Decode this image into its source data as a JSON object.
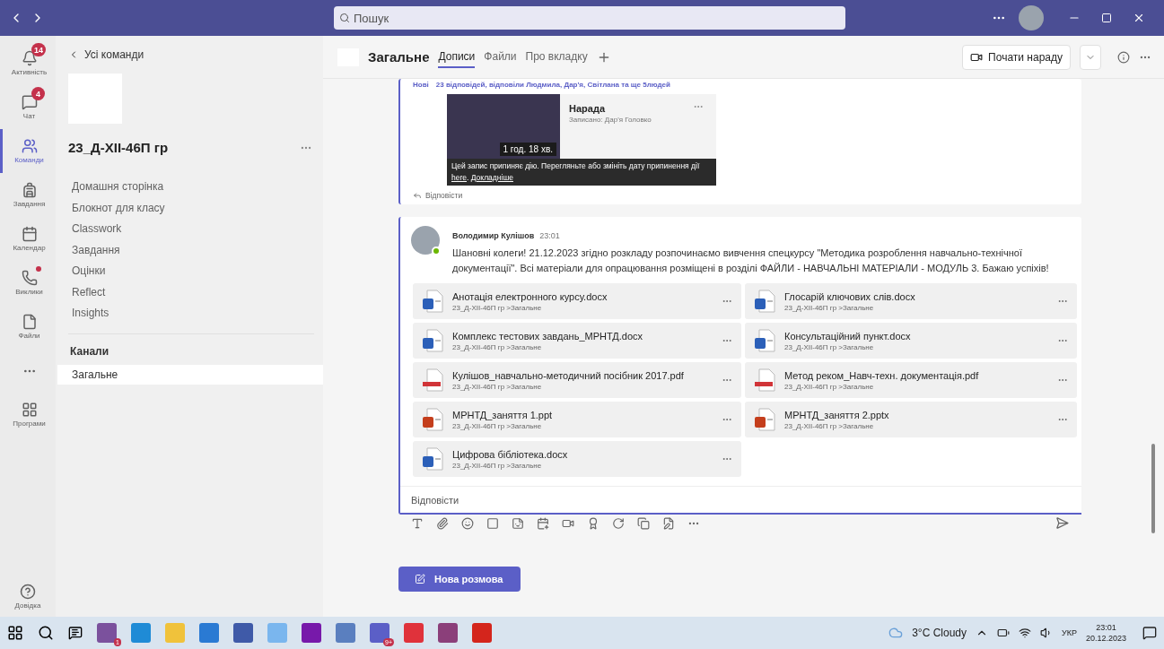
{
  "titlebar": {
    "search_placeholder": "Пошук"
  },
  "rail": [
    {
      "label": "Активність",
      "badge": "14",
      "alert": false,
      "selected": false
    },
    {
      "label": "Чат",
      "badge": "4",
      "alert": false,
      "selected": false
    },
    {
      "label": "Команди",
      "alert": false,
      "selected": true
    },
    {
      "label": "Завдання",
      "alert": false,
      "selected": false
    },
    {
      "label": "Календар",
      "alert": false,
      "selected": false
    },
    {
      "label": "Виклики",
      "alert": true,
      "selected": false
    },
    {
      "label": "Файли",
      "alert": false,
      "selected": false
    }
  ],
  "rail_apps": {
    "label": "Програми"
  },
  "rail_help": {
    "label": "Довідка"
  },
  "team_panel": {
    "back": "Усі команди",
    "team_name": "23_Д-XII-46П гр",
    "nav": [
      "Домашня сторінка",
      "Блокнот для класу",
      "Classwork",
      "Завдання",
      "Оцінки",
      "Reflect",
      "Insights"
    ],
    "section": "Канали",
    "channels": [
      {
        "label": "Загальне",
        "selected": true
      }
    ]
  },
  "header": {
    "channel": "Загальне",
    "tabs": [
      {
        "label": "Дописи",
        "selected": true
      },
      {
        "label": "Файли",
        "selected": false
      },
      {
        "label": "Про вкладку",
        "selected": false
      }
    ],
    "meet_button": "Почати нараду"
  },
  "thread": {
    "new_label": "Нові",
    "replies_summary": "23 відповідей, відповіли Людмила, Дар'я, Світлана та ще 5людей",
    "recording": {
      "title": "Нарада",
      "recorded_by": "Записано: Дар'я Головко",
      "duration": "1 год. 18 хв.",
      "notice": "Цей запис припиняє дію. Перегляньте або змініть дату припинення дії",
      "link": "here",
      "notice_end": ".",
      "link2": "Докладніше"
    },
    "reply": "Відповісти"
  },
  "message": {
    "author": "Володимир Кулішов",
    "time": "23:01",
    "body": "Шановні колеги! 21.12.2023 згідно розкладу розпочинаємо вивчення спецкурсу \"Методика розроблення навчально-технічної документації\". Всі матеріали для опрацювання розміщені в розділі ФАЙЛИ - НАВЧАЛЬНІ МАТЕРІАЛИ - МОДУЛЬ 3. Бажаю успіхів!",
    "files": [
      {
        "name": "Анотація електронного курсу.docx",
        "location": "23_Д-XII-46П гр >Загальне",
        "kind": "word"
      },
      {
        "name": "Глосарій ключових слів.docx",
        "location": "23_Д-XII-46П гр >Загальне",
        "kind": "word"
      },
      {
        "name": "Комплекс тестових завдань_МРНТД.docx",
        "location": "23_Д-XII-46П гр >Загальне",
        "kind": "word"
      },
      {
        "name": "Консультаційний пункт.docx",
        "location": "23_Д-XII-46П гр >Загальне",
        "kind": "word"
      },
      {
        "name": "Кулішов_навчально-методичний посібник 2017.pdf",
        "location": "23_Д-XII-46П гр >Загальне",
        "kind": "pdf"
      },
      {
        "name": "Метод реком_Навч-техн. документація.pdf",
        "location": "23_Д-XII-46П гр >Загальне",
        "kind": "pdf"
      },
      {
        "name": "МРНТД_заняття 1.ppt",
        "location": "23_Д-XII-46П гр >Загальне",
        "kind": "ppt"
      },
      {
        "name": "МРНТД_заняття 2.pptx",
        "location": "23_Д-XII-46П гр >Загальне",
        "kind": "ppt"
      },
      {
        "name": "Цифрова бібліотека.docx",
        "location": "23_Д-XII-46П гр >Загальне",
        "kind": "word"
      }
    ],
    "reply_placeholder": "Відповісти"
  },
  "new_conversation": "Нова розмова",
  "taskbar": {
    "apps": [
      {
        "kind": "viber",
        "badge": "1"
      },
      {
        "kind": "edge"
      },
      {
        "kind": "explorer"
      },
      {
        "kind": "mail"
      },
      {
        "kind": "save"
      },
      {
        "kind": "play"
      },
      {
        "kind": "onenote"
      },
      {
        "kind": "word"
      },
      {
        "kind": "teams",
        "badge": "9+"
      },
      {
        "kind": "opera"
      },
      {
        "kind": "winrar"
      },
      {
        "kind": "acrobat"
      }
    ],
    "weather": "3°C Cloudy",
    "language": "УКР",
    "time": "23:01",
    "date": "20.12.2023"
  }
}
